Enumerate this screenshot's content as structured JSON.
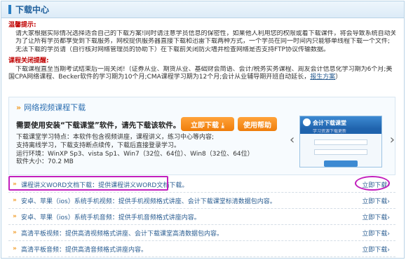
{
  "header": {
    "title": "下载中心"
  },
  "notice": {
    "tip_heading": "温馨提示:",
    "tip_lines": [
      "请大家根据实际情况选择适合自己的下载方案!同时请注意学员信息的保密性，如果他人利用您的权限或着下载课件，将会导致系统自动关闭您的下载听课权限;",
      "为了让所有学员都享受到下载服务，网校提供服务器直接下载和迅雷下载两种方式，一个学员在同一时间内只能够单线程下载一个文件;",
      "无法下载的学员请（自行核对网络管理员的协助下）在下载前关闭防火墙并检查网络是否支持FTP协议传输数据。"
    ],
    "close_heading": "课程关闭提醒:",
    "close_text": "下载课程直至当期考试结束后一周关闭!（证券从业、期货从业、基础财会简语、会计/税务实务课程、周友会计信息化学习期为6个月;美国CPA网络课程、Becker软件的学习期为10个月;CMA课程学习期为12个月;会计从业辅导期开班自动延长，",
    "close_link": "报生方案",
    "close_tail": "）"
  },
  "video_section": {
    "title": "网络视频课程下载",
    "lead": "需要使用安装“下载课堂”软件，请先下载该软件。",
    "download_button": "立即下载 ⤓",
    "help_button": "使用帮助",
    "spec_lines": [
      "下载课堂学习特点：本软件包含视频讲座，课程讲义，练习中心等内容;",
      "支持离线学习，下载支持断点续传，下载后直接登录学习。",
      "运行环境：WinXP Sp3、vista Sp1、Win7（32位、64位）、Win8（32位、64位）",
      "软件大小：70.2 MB"
    ],
    "preview_title": "会计下载课堂",
    "preview_subtitle": "学习资源下载更新"
  },
  "downloads": [
    {
      "text": "课程讲义WORD文档下载：提供课程讲义WORD文档下载。",
      "action": "立即下载›"
    },
    {
      "text": "安卓、苹果（ios）系统手机视频：提供手机视频格式讲座、会计下载课堂标清数据包内容。",
      "action": "立即下载›"
    },
    {
      "text": "安卓、苹果（ios）系统手机音频：提供手机音频格式讲座内容。",
      "action": "立即下载›"
    },
    {
      "text": "高清平板视频：提供高清视频格式讲座、会计下载课堂高清数据包内容。",
      "action": "立即下载›"
    },
    {
      "text": "高清平板音频：提供高清音频格式讲座内容。",
      "action": "立即下载›"
    }
  ],
  "colors": {
    "accent": "#2a7fc4",
    "orange": "#ef7d0b",
    "highlight": "#c21fbd",
    "link": "#2a5d91"
  }
}
